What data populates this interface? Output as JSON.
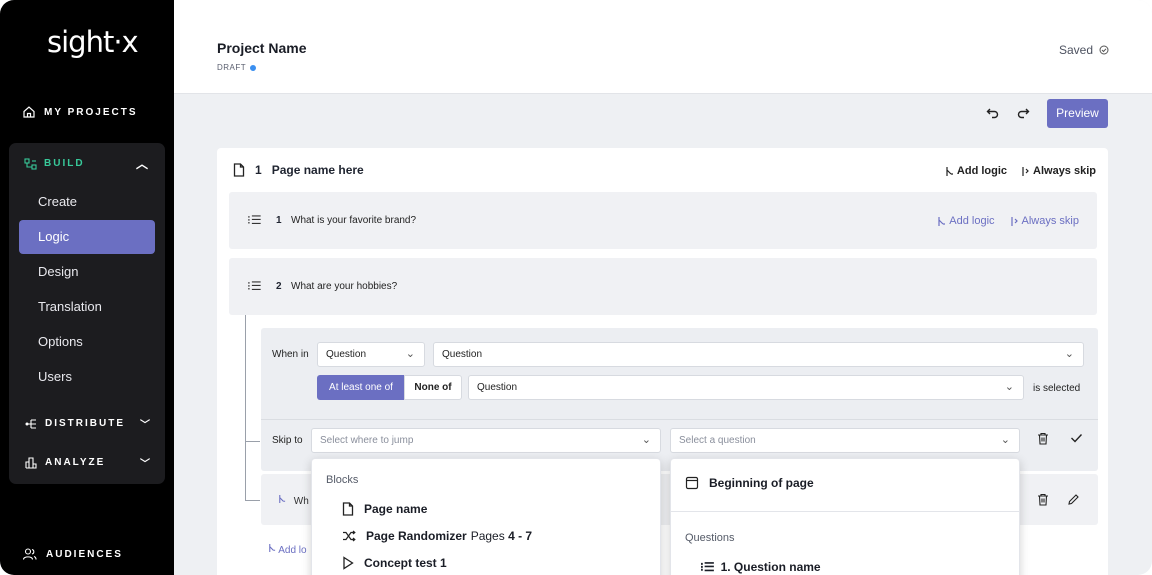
{
  "sidebar": {
    "logo": "sight·x",
    "my_projects": "MY PROJECTS",
    "build": "BUILD",
    "build_items": [
      "Create",
      "Logic",
      "Design",
      "Translation",
      "Options",
      "Users"
    ],
    "active_item": "Logic",
    "distribute": "DISTRIBUTE",
    "analyze": "ANALYZE",
    "audiences": "AUDIENCES"
  },
  "header": {
    "project_name": "Project Name",
    "status": "DRAFT",
    "saved": "Saved"
  },
  "toolbar": {
    "preview": "Preview"
  },
  "page": {
    "number": "1",
    "name": "Page name here",
    "add_logic": "Add logic",
    "always_skip": "Always skip"
  },
  "questions": [
    {
      "number": "1",
      "text": "What is your favorite brand?",
      "add_logic": "Add logic",
      "always_skip": "Always skip"
    },
    {
      "number": "2",
      "text": "What are your hobbies?"
    }
  ],
  "logic": {
    "when_in": "When in",
    "scope_select": "Question",
    "question_select": "Question",
    "seg_on": "At least one of",
    "seg_off": "None of",
    "answer_select": "Question",
    "is_selected": "is selected",
    "skip_to": "Skip to",
    "jump_placeholder": "Select where to jump",
    "question_placeholder": "Select a question"
  },
  "row3": {
    "text_fragment": "Wh"
  },
  "bottom_add_logic": "Add lo",
  "dropdown_blocks": {
    "section": "Blocks",
    "items": [
      {
        "icon": "page-icon",
        "label": "Page name",
        "extra_prefix": "",
        "extra_bold": ""
      },
      {
        "icon": "shuffle-icon",
        "label": "Page Randomizer",
        "extra_prefix": "Pages ",
        "extra_bold": "4 - 7"
      },
      {
        "icon": "play-icon",
        "label": "Concept test 1",
        "extra_prefix": "",
        "extra_bold": ""
      }
    ]
  },
  "dropdown_questions": {
    "top_item": "Beginning of page",
    "section": "Questions",
    "items": [
      "1. Question name"
    ]
  },
  "colors": {
    "accent": "#6b6fc2",
    "build_green": "#38c99a",
    "draft_dot": "#3b8ff0"
  }
}
